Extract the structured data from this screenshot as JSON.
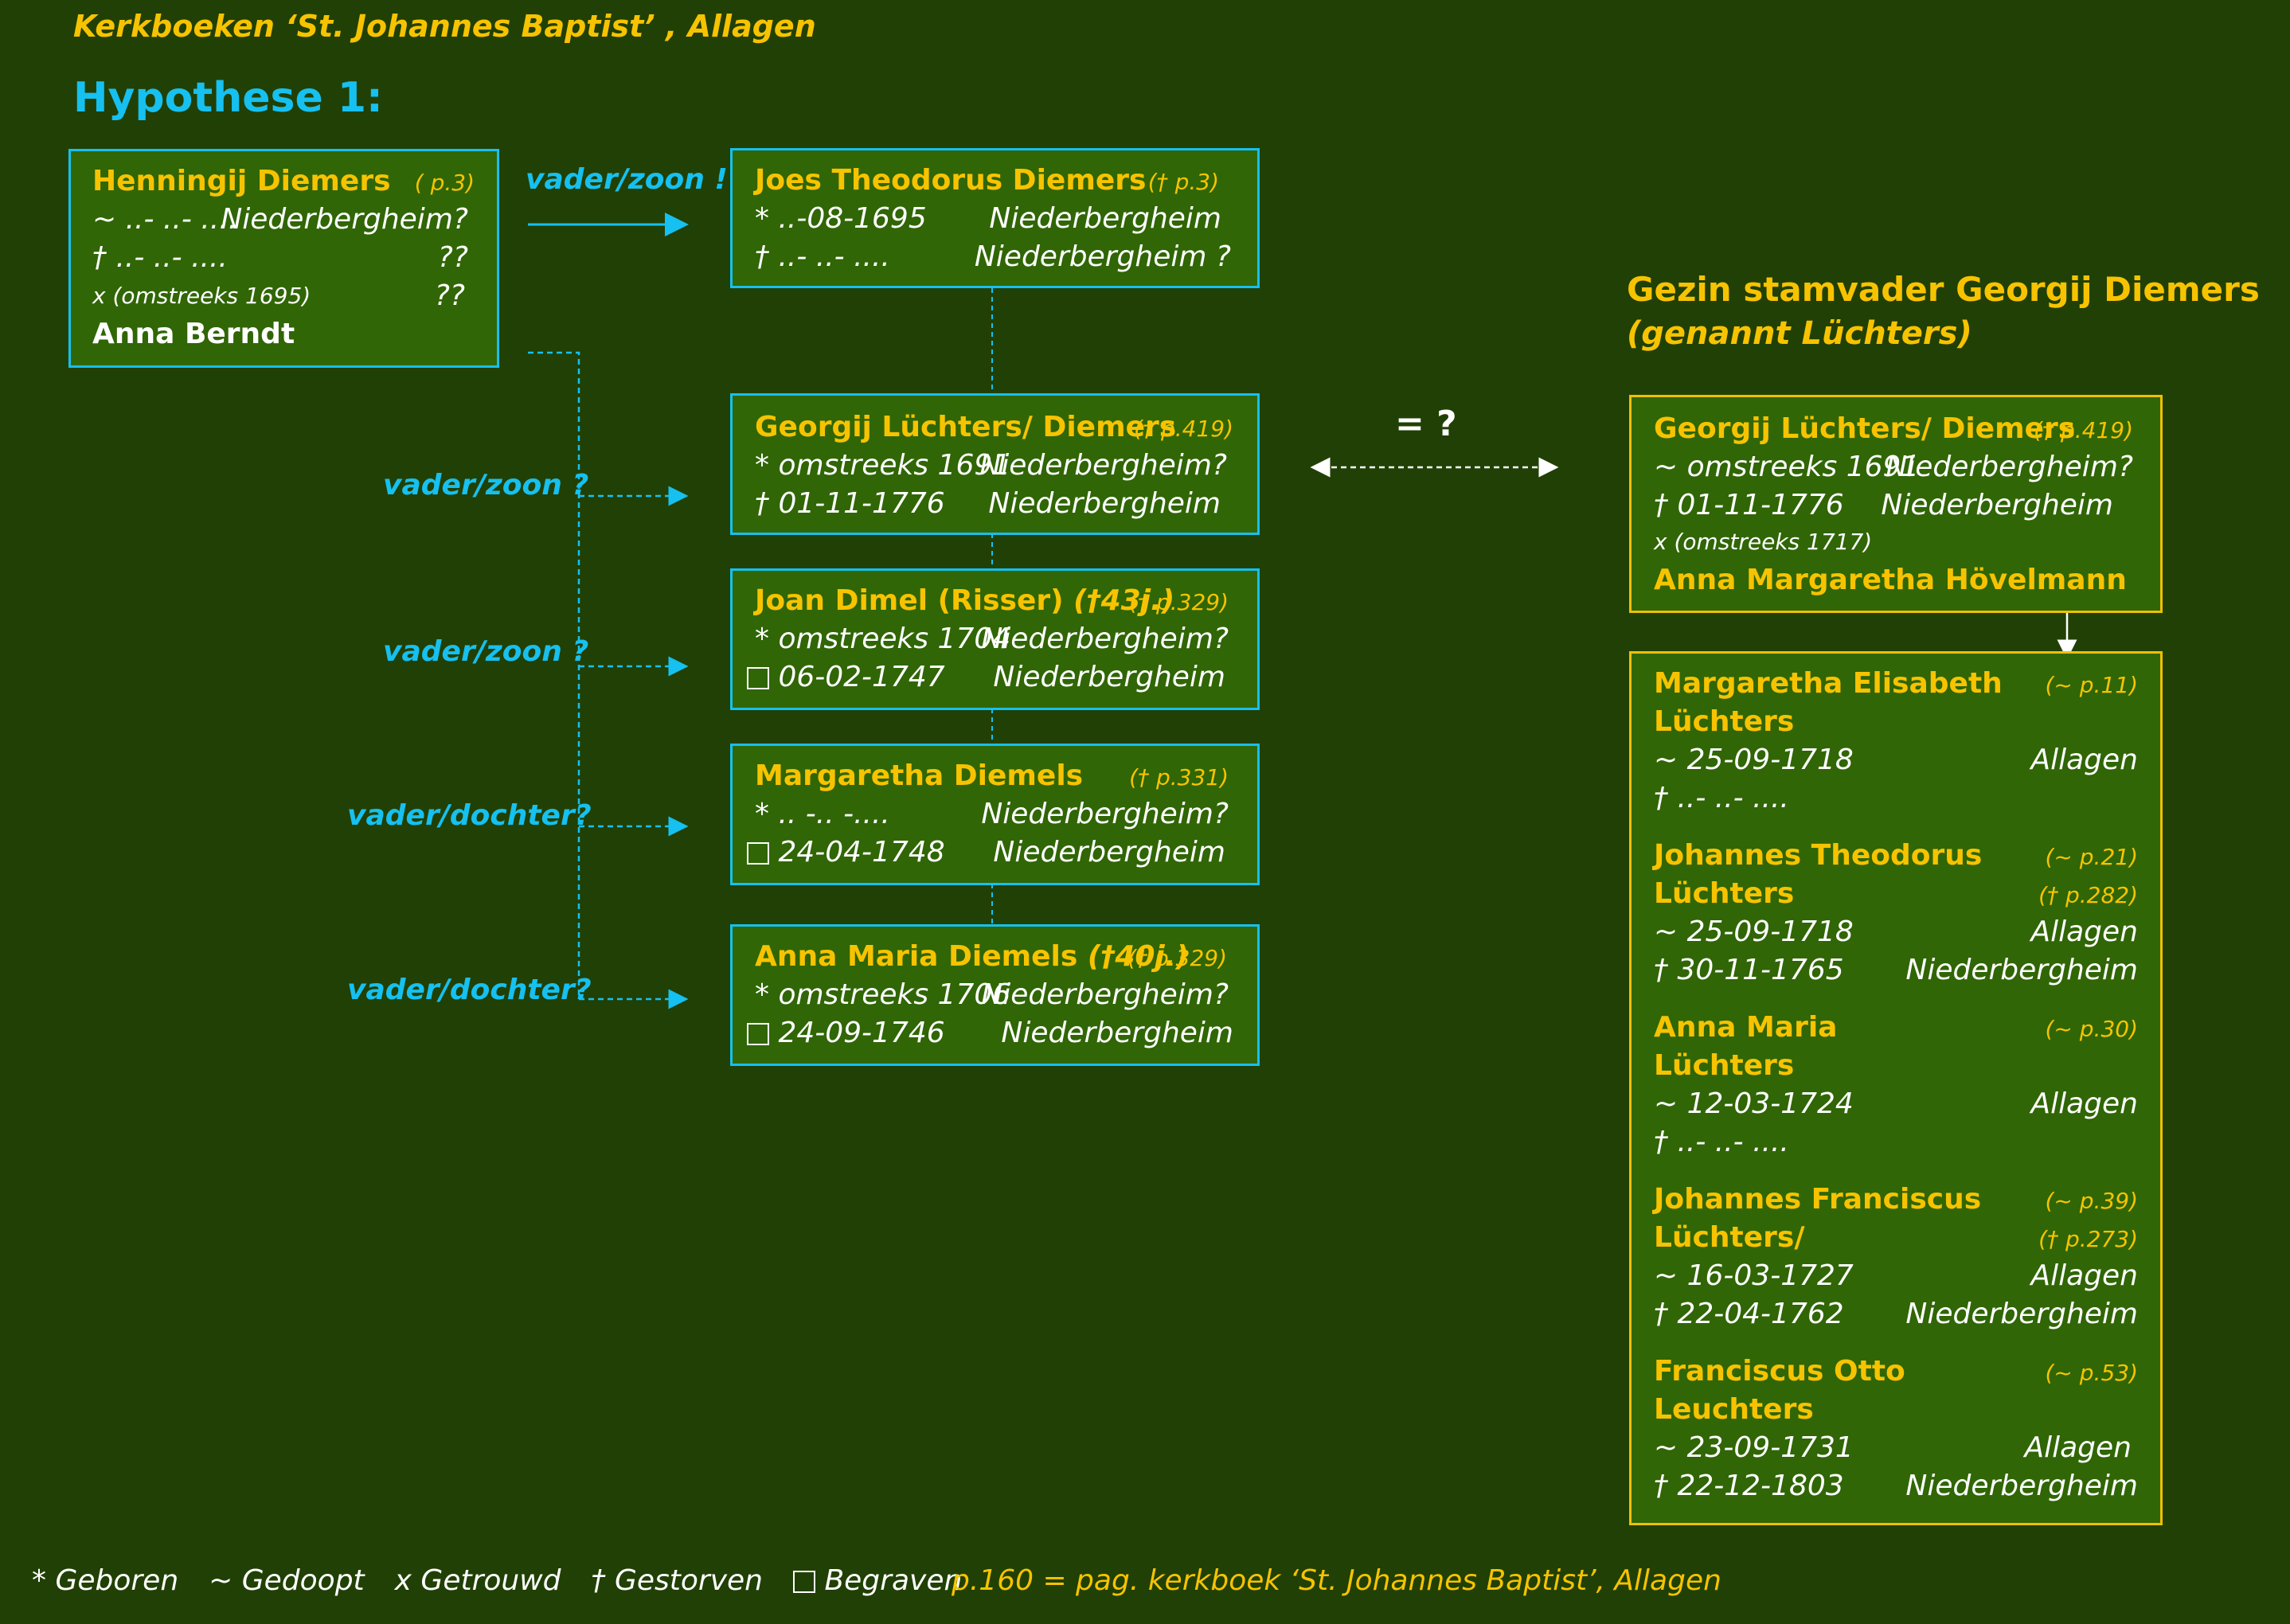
{
  "header": {
    "title": "Kerkboeken ‘St. Johannes Baptist’ , Allagen",
    "hypothesis": "Hypothese 1:"
  },
  "colors": {
    "background": "#214005",
    "box_fill": "#306605",
    "cyan": "#16c0f0",
    "yellow": "#f7c300",
    "white": "#ffffff"
  },
  "henning": {
    "name": "Henningij Diemers",
    "ref": "( p.3)",
    "bap_date": "~ ..-   ..-   ....",
    "bap_place": "Niederbergheim?",
    "death_date": "† ..-   ..-   ....",
    "death_place": "??",
    "marriage": "x (omstreeks 1695)",
    "marriage_q": "??",
    "spouse": "Anna Berndt"
  },
  "relations": {
    "r1": "vader/zoon !",
    "r2": "vader/zoon ?",
    "r3": "vader/zoon ?",
    "r4": "vader/dochter?",
    "r5": "vader/dochter?"
  },
  "joes": {
    "name": "Joes Theodorus Diemers",
    "ref": "(† p.3)",
    "birth_date": "* ..-08-1695",
    "birth_place": "Niederbergheim",
    "death_date": "† ..- ..- ....",
    "death_place": "Niederbergheim ?"
  },
  "georgij_mid": {
    "name": "Georgij Lüchters/ Diemers",
    "ref": "(† p.419)",
    "birth_date": "*  omstreeks 1691",
    "birth_place": "Niederbergheim?",
    "death_date": "† 01-11-1776",
    "death_place": "Niederbergheim"
  },
  "joan": {
    "name": "Joan Dimel (Risser)",
    "age": "(†43j.)",
    "ref": "(† p.329)",
    "birth_date": "* omstreeks 1704",
    "birth_place": "Niederbergheim?",
    "burial_date": "06-02-1747",
    "burial_place": "Niederbergheim"
  },
  "margaretha_d": {
    "name": "Margaretha Diemels",
    "ref": "(† p.331)",
    "birth_date": "* ..  -..  -....",
    "birth_place": "Niederbergheim?",
    "burial_date": "24-04-1748",
    "burial_place": "Niederbergheim"
  },
  "anna_maria_d": {
    "name": "Anna Maria Diemels",
    "age": "(†40j.)",
    "ref": "(† p.329)",
    "birth_date": "* omstreeks 1706",
    "birth_place": "Niederbergheim?",
    "burial_date": "24-09-1746",
    "burial_place": "Niederbergheim"
  },
  "equality": "= ?",
  "family": {
    "title": "Gezin stamvader  Georgij Diemers",
    "subtitle": "(genannt Lüchters)",
    "father": {
      "name": "Georgij Lüchters/ Diemers",
      "ref": "(† p.419)",
      "bap_date": "~ omstreeks 1691",
      "bap_place": "Niederbergheim?",
      "death_date": "† 01-11-1776",
      "death_place": "Niederbergheim",
      "marriage": "x (omstreeks 1717)",
      "spouse": "Anna Margaretha Hövelmann"
    },
    "children": [
      {
        "name1": "Margaretha Elisabeth",
        "name2": "Lüchters",
        "ref1": "(~ p.11)",
        "ref2": "",
        "l1_date": "~  25-09-1718",
        "l1_place": "Allagen",
        "l2_date": "†  ..-  ..-   ....",
        "l2_place": ""
      },
      {
        "name1": "Johannes Theodorus",
        "name2": "Lüchters",
        "ref1": "(~ p.21)",
        "ref2": "(† p.282)",
        "l1_date": "~  25-09-1718",
        "l1_place": "Allagen",
        "l2_date": "†  30-11-1765",
        "l2_place": "Niederbergheim"
      },
      {
        "name1": "Anna Maria",
        "name2": "Lüchters",
        "ref1": "(~ p.30)",
        "ref2": "",
        "l1_date": "~ 12-03-1724",
        "l1_place": "Allagen",
        "l2_date": "†  ..-  ..-   ....",
        "l2_place": ""
      },
      {
        "name1": "Johannes Franciscus",
        "name2": "Lüchters/",
        "ref1": "(~ p.39)",
        "ref2": "(† p.273)",
        "l1_date": "~  16-03-1727",
        "l1_place": "Allagen",
        "l2_date": "†  22-04-1762",
        "l2_place": "Niederbergheim"
      },
      {
        "name1": "Franciscus Otto",
        "name2": "Leuchters",
        "ref1": "(~ p.53)",
        "ref2": "",
        "l1_date": "~  23-09-1731",
        "l1_place": "Allagen",
        "l2_date": "†  22-12-1803",
        "l2_place": "Niederbergheim"
      }
    ]
  },
  "legend": {
    "born": "* Geboren",
    "baptized": "~ Gedoopt",
    "married": "x Getrouwd",
    "died": "† Gestorven",
    "buried": "Begraven",
    "page_note": "p.160 = pag. kerkboek ‘St. Johannes Baptist’, Allagen"
  }
}
